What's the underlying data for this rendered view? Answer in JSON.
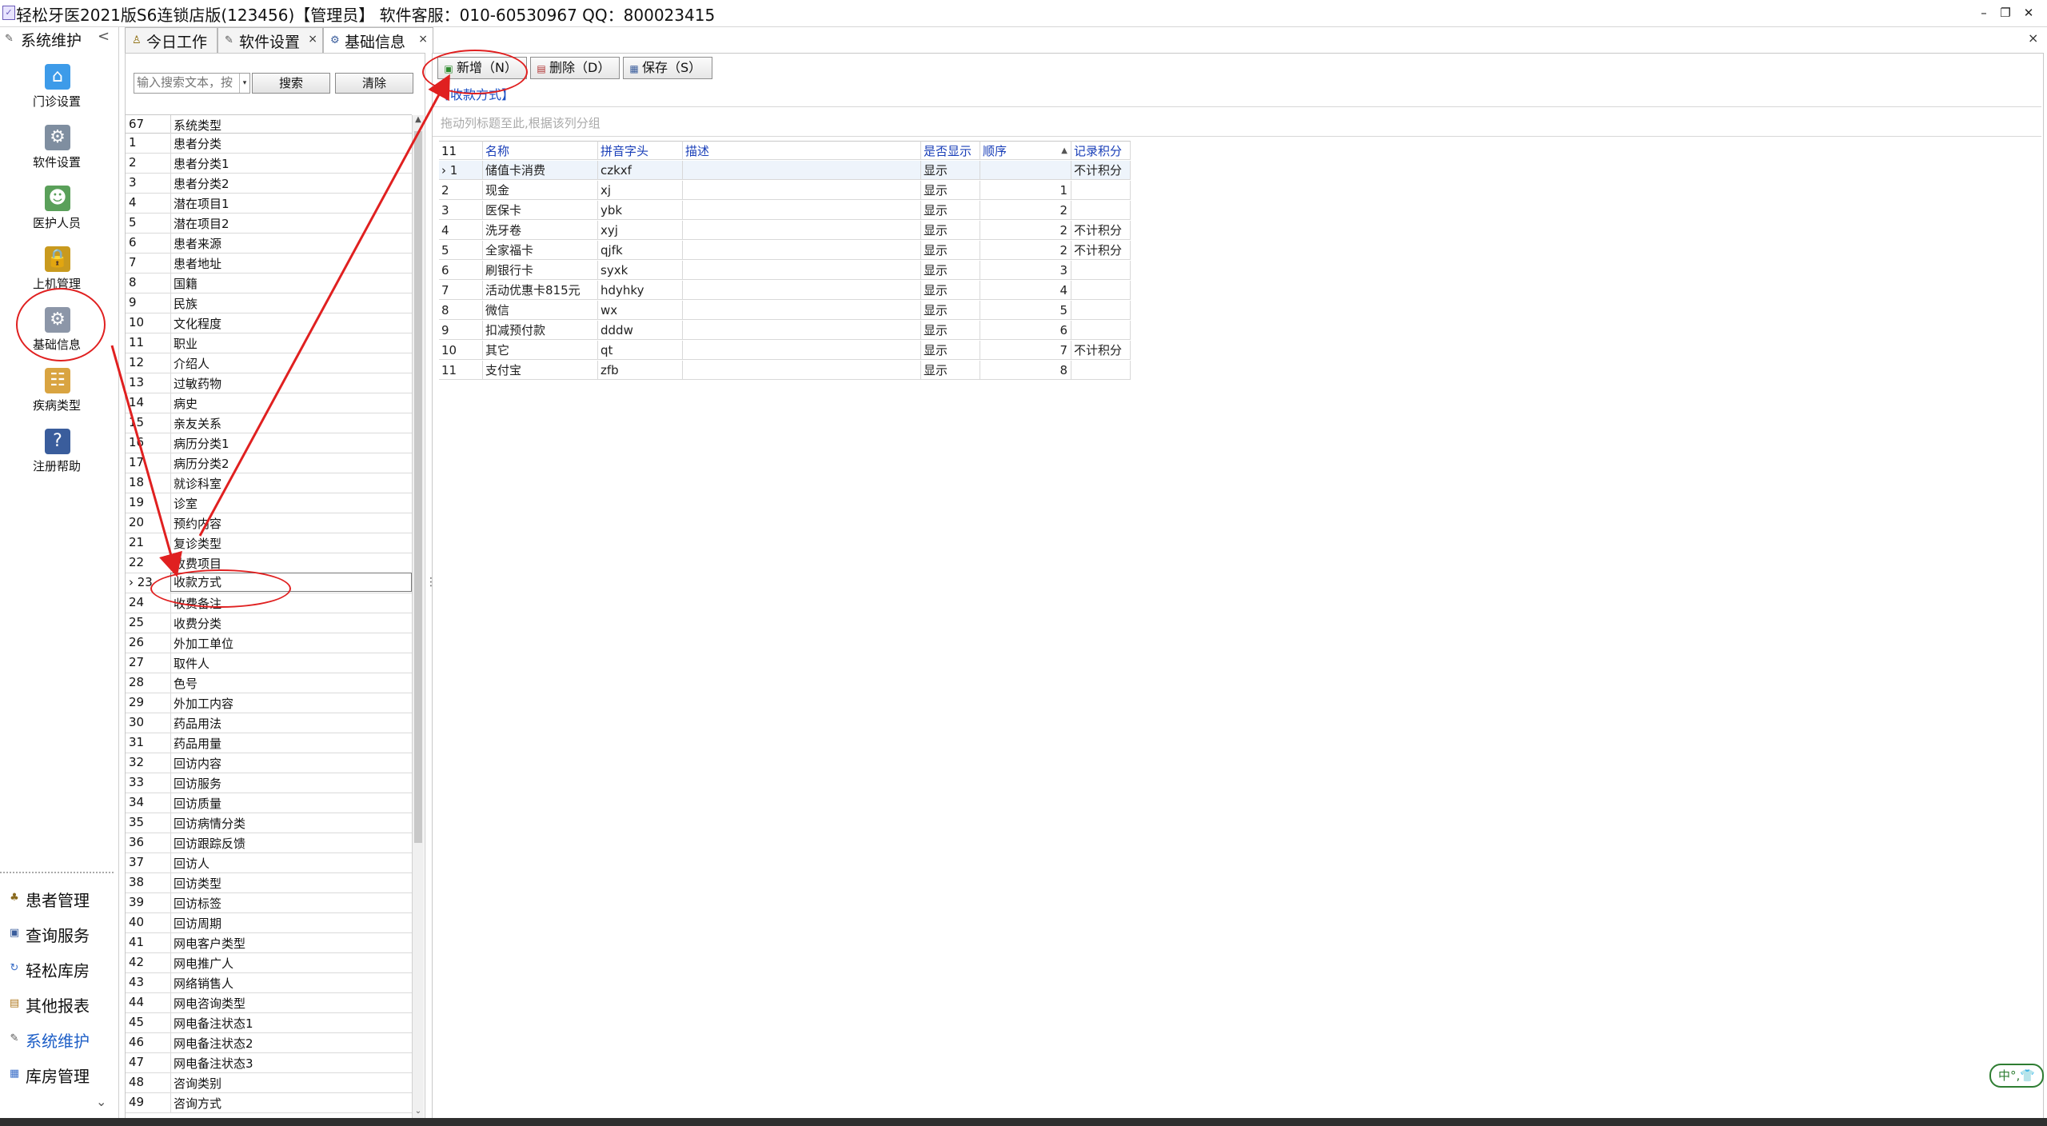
{
  "window": {
    "title": "轻松牙医2021版S6连锁店版(123456)【管理员】   软件客服：010-60530967 QQ：800023415",
    "minimize": "–",
    "restore": "❐",
    "close": "✕"
  },
  "sidebar": {
    "header": "系统维护",
    "collapse": "<",
    "tools": [
      {
        "label": "门诊设置",
        "icon": "house-icon"
      },
      {
        "label": "软件设置",
        "icon": "gears-icon"
      },
      {
        "label": "医护人员",
        "icon": "users-icon"
      },
      {
        "label": "上机管理",
        "icon": "lock-icon"
      },
      {
        "label": "基础信息",
        "icon": "gear-document-icon"
      },
      {
        "label": "疾病类型",
        "icon": "hierarchy-icon"
      },
      {
        "label": "注册帮助",
        "icon": "help-icon"
      }
    ],
    "separator": "......",
    "nav": [
      {
        "label": "患者管理",
        "icon": "users-small-icon"
      },
      {
        "label": "查询服务",
        "icon": "search-window-icon"
      },
      {
        "label": "轻松库房",
        "icon": "warehouse-icon"
      },
      {
        "label": "其他报表",
        "icon": "report-icon"
      },
      {
        "label": "系统维护",
        "icon": "tools-icon"
      },
      {
        "label": "库房管理",
        "icon": "inventory-icon"
      }
    ],
    "more": "⌄"
  },
  "tabs": [
    {
      "label": "今日工作",
      "closable": false
    },
    {
      "label": "软件设置",
      "closable": true,
      "close": "×"
    },
    {
      "label": "基础信息",
      "closable": true,
      "close": "×"
    }
  ],
  "tabs_close_all": "×",
  "left_panel": {
    "search_placeholder": "输入搜索文本，按",
    "search_button": "搜索",
    "clear_button": "清除",
    "count": "67",
    "column_header": "系统类型",
    "selected_index": 22,
    "rows": [
      "患者分类",
      "患者分类1",
      "患者分类2",
      "潜在项目1",
      "潜在项目2",
      "患者来源",
      "患者地址",
      "国籍",
      "民族",
      "文化程度",
      "职业",
      "介绍人",
      "过敏药物",
      "病史",
      "亲友关系",
      "病历分类1",
      "病历分类2",
      "就诊科室",
      "诊室",
      "预约内容",
      "复诊类型",
      "收费项目",
      "收款方式",
      "收费备注",
      "收费分类",
      "外加工单位",
      "取件人",
      "色号",
      "外加工内容",
      "药品用法",
      "药品用量",
      "回访内容",
      "回访服务",
      "回访质量",
      "回访病情分类",
      "回访跟踪反馈",
      "回访人",
      "回访类型",
      "回访标签",
      "回访周期",
      "网电客户类型",
      "网电推广人",
      "网络销售人",
      "网电咨询类型",
      "网电备注状态1",
      "网电备注状态2",
      "网电备注状态3",
      "咨询类别",
      "咨询方式"
    ]
  },
  "right_panel": {
    "buttons": {
      "add": "新增（N）",
      "delete": "删除（D）",
      "save": "保存（S）"
    },
    "caption": "【收款方式】",
    "group_hint": "拖动列标题至此,根据该列分组",
    "count": "11",
    "columns": [
      "名称",
      "拼音字头",
      "描述",
      "是否显示",
      "顺序",
      "记录积分"
    ],
    "sort_indicator": "▲",
    "rows": [
      {
        "n": "1",
        "name": "储值卡消费",
        "py": "czkxf",
        "desc": "",
        "show": "显示",
        "order": "",
        "points": "不计积分"
      },
      {
        "n": "2",
        "name": "现金",
        "py": "xj",
        "desc": "",
        "show": "显示",
        "order": "1",
        "points": ""
      },
      {
        "n": "3",
        "name": "医保卡",
        "py": "ybk",
        "desc": "",
        "show": "显示",
        "order": "2",
        "points": ""
      },
      {
        "n": "4",
        "name": "洗牙卷",
        "py": "xyj",
        "desc": "",
        "show": "显示",
        "order": "2",
        "points": "不计积分"
      },
      {
        "n": "5",
        "name": "全家福卡",
        "py": "qjfk",
        "desc": "",
        "show": "显示",
        "order": "2",
        "points": "不计积分"
      },
      {
        "n": "6",
        "name": "刷银行卡",
        "py": "syxk",
        "desc": "",
        "show": "显示",
        "order": "3",
        "points": ""
      },
      {
        "n": "7",
        "name": "活动优惠卡815元",
        "py": "hdyhky",
        "desc": "",
        "show": "显示",
        "order": "4",
        "points": ""
      },
      {
        "n": "8",
        "name": "微信",
        "py": "wx",
        "desc": "",
        "show": "显示",
        "order": "5",
        "points": ""
      },
      {
        "n": "9",
        "name": "扣减预付款",
        "py": "dddw",
        "desc": "",
        "show": "显示",
        "order": "6",
        "points": ""
      },
      {
        "n": "10",
        "name": "其它",
        "py": "qt",
        "desc": "",
        "show": "显示",
        "order": "7",
        "points": "不计积分"
      },
      {
        "n": "11",
        "name": "支付宝",
        "py": "zfb",
        "desc": "",
        "show": "显示",
        "order": "8",
        "points": ""
      }
    ]
  },
  "ime": "中°,👕",
  "colors": {
    "annotation": "#e02020",
    "link_blue": "#1a4fc4",
    "header_blue": "#1a3fb8"
  }
}
